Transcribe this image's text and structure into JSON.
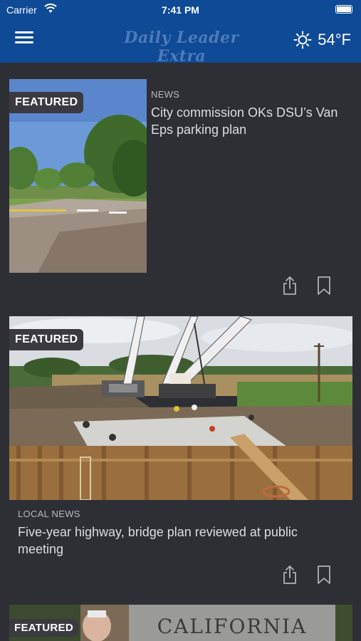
{
  "status_bar": {
    "carrier": "Carrier",
    "time": "7:41 PM"
  },
  "header": {
    "logo_text": "Daily Leader Extra",
    "weather_icon": "sun-icon",
    "temperature": "54°F",
    "menu_icon": "hamburger-menu-icon"
  },
  "articles": [
    {
      "badge": "FEATURED",
      "category": "NEWS",
      "headline": "City commission OKs DSU’s Van Eps parking plan",
      "share_icon": "share-icon",
      "bookmark_icon": "bookmark-icon"
    },
    {
      "badge": "FEATURED",
      "category": "LOCAL NEWS",
      "headline": "Five-year highway, bridge plan reviewed at public meeting",
      "share_icon": "share-icon",
      "bookmark_icon": "bookmark-icon"
    },
    {
      "badge": "FEATURED",
      "image_text": "CALIFORNIA"
    }
  ],
  "colors": {
    "header_bg": "#0e4a96",
    "feed_bg": "#2e2e35",
    "badge_bg": "#3a3a40"
  }
}
